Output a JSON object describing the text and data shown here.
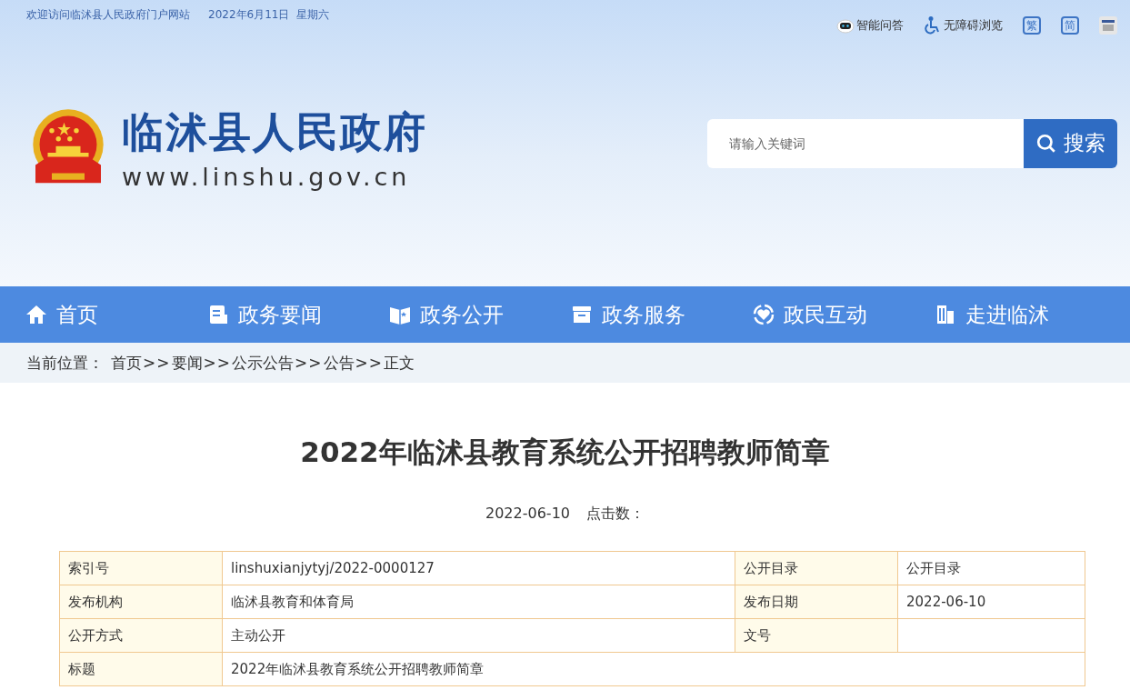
{
  "top_bar": {
    "welcome": "欢迎访问临沭县人民政府门户网站",
    "date": "2022年6月11日",
    "weekday": "星期六",
    "tools": [
      {
        "kind": "robot",
        "label": "智能问答"
      },
      {
        "kind": "wheelchair",
        "label": "无障碍浏览"
      },
      {
        "kind": "boxed",
        "label": "繁"
      },
      {
        "kind": "boxed",
        "label": "简"
      },
      {
        "kind": "badge"
      }
    ]
  },
  "header": {
    "site_name": "临沭县人民政府",
    "domain": "www.linshu.gov.cn",
    "search": {
      "placeholder": "请输入关键词",
      "button": "搜索"
    }
  },
  "nav": [
    {
      "kind": "home",
      "label": "首页"
    },
    {
      "kind": "doc",
      "label": "政务要闻"
    },
    {
      "kind": "book",
      "label": "政务公开"
    },
    {
      "kind": "box",
      "label": "政务服务"
    },
    {
      "kind": "heart",
      "label": "政民互动"
    },
    {
      "kind": "building",
      "label": "走进临沭"
    }
  ],
  "breadcrumb": {
    "label": "当前位置：",
    "items": [
      {
        "kind": "link",
        "text": "首页"
      },
      {
        "kind": "sep",
        "text": ">>"
      },
      {
        "kind": "link",
        "text": "要闻"
      },
      {
        "kind": "sep",
        "text": ">>"
      },
      {
        "kind": "link",
        "text": "公示公告"
      },
      {
        "kind": "sep",
        "text": ">>"
      },
      {
        "kind": "link",
        "text": "公告"
      },
      {
        "kind": "sep",
        "text": ">>"
      },
      {
        "kind": "link",
        "text": "正文"
      }
    ]
  },
  "article": {
    "title": "2022年临沭县教育系统公开招聘教师简章",
    "date": "2022-06-10",
    "hits_label": "点击数："
  },
  "info_table": {
    "rows": [
      [
        {
          "kind": "label",
          "text": "索引号"
        },
        {
          "kind": "value",
          "text": "linshuxianjytyj/2022-0000127"
        },
        {
          "kind": "label",
          "text": "公开目录"
        },
        {
          "kind": "value",
          "text": "公开目录"
        }
      ],
      [
        {
          "kind": "label",
          "text": "发布机构"
        },
        {
          "kind": "value",
          "text": "临沭县教育和体育局"
        },
        {
          "kind": "label",
          "text": "发布日期"
        },
        {
          "kind": "value",
          "text": "2022-06-10"
        }
      ],
      [
        {
          "kind": "label",
          "text": "公开方式"
        },
        {
          "kind": "value",
          "text": "主动公开"
        },
        {
          "kind": "label",
          "text": "文号"
        },
        {
          "kind": "value"
        }
      ],
      [
        {
          "kind": "label",
          "text": "标题"
        },
        {
          "kind": "value",
          "text": "2022年临沭县教育系统公开招聘教师简章",
          "colspan": 3
        }
      ]
    ]
  }
}
